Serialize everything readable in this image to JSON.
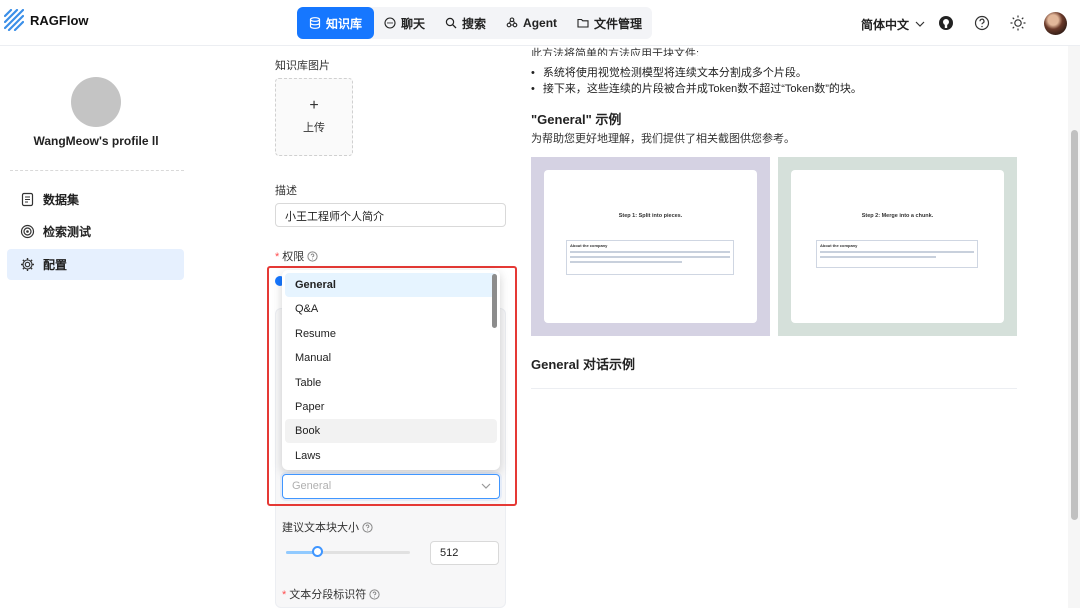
{
  "header": {
    "app_name": "RAGFlow",
    "nav": [
      {
        "label": "知识库",
        "icon": "database-icon",
        "active": true
      },
      {
        "label": "聊天",
        "icon": "chat-icon"
      },
      {
        "label": "搜索",
        "icon": "search-icon"
      },
      {
        "label": "Agent",
        "icon": "agent-icon"
      },
      {
        "label": "文件管理",
        "icon": "folder-icon"
      }
    ],
    "language": "简体中文",
    "icons": [
      "github-icon",
      "help-icon",
      "sun-icon",
      "user-avatar"
    ]
  },
  "sidebar": {
    "profile_name": "WangMeow's profile ll",
    "items": [
      {
        "label": "数据集",
        "icon": "file-text-icon"
      },
      {
        "label": "检索测试",
        "icon": "target-icon"
      },
      {
        "label": "配置",
        "icon": "gear-icon",
        "active": true
      }
    ]
  },
  "form": {
    "image_label": "知识库图片",
    "upload_plus": "+",
    "upload_text": "上传",
    "description_label": "描述",
    "description_value": "小王工程师个人简介",
    "permission_label": "权限",
    "chunk_method": {
      "options": [
        "General",
        "Q&A",
        "Resume",
        "Manual",
        "Table",
        "Paper",
        "Book",
        "Laws"
      ],
      "selected": "General",
      "hovered": "Book",
      "placeholder": "General"
    },
    "chunk_size_label": "建议文本块大小",
    "chunk_size_value": "512",
    "chunk_size_fraction": 0.25,
    "delimiter_label": "文本分段标识符"
  },
  "content": {
    "cut_line": "此方法将简单的方法应用于块文件:",
    "bullets": [
      "系统将使用视觉检测模型将连续文本分割成多个片段。",
      "接下来，这些连续的片段被合并成Token数不超过“Token数”的块。"
    ],
    "example_title": "\"General\" 示例",
    "example_sub": "为帮助您更好地理解，我们提供了相关截图供您参考。",
    "example_images": [
      {
        "step": "Step 1: Split into pieces.",
        "box_title": "About the company",
        "bg": "#d5d2e3"
      },
      {
        "step": "Step 2: Merge into a chunk.",
        "box_title": "About the company",
        "bg": "#d5e0da"
      }
    ],
    "dialog_example_title": "General 对话示例"
  },
  "colors": {
    "primary": "#1677ff",
    "highlight": "#e53935"
  }
}
